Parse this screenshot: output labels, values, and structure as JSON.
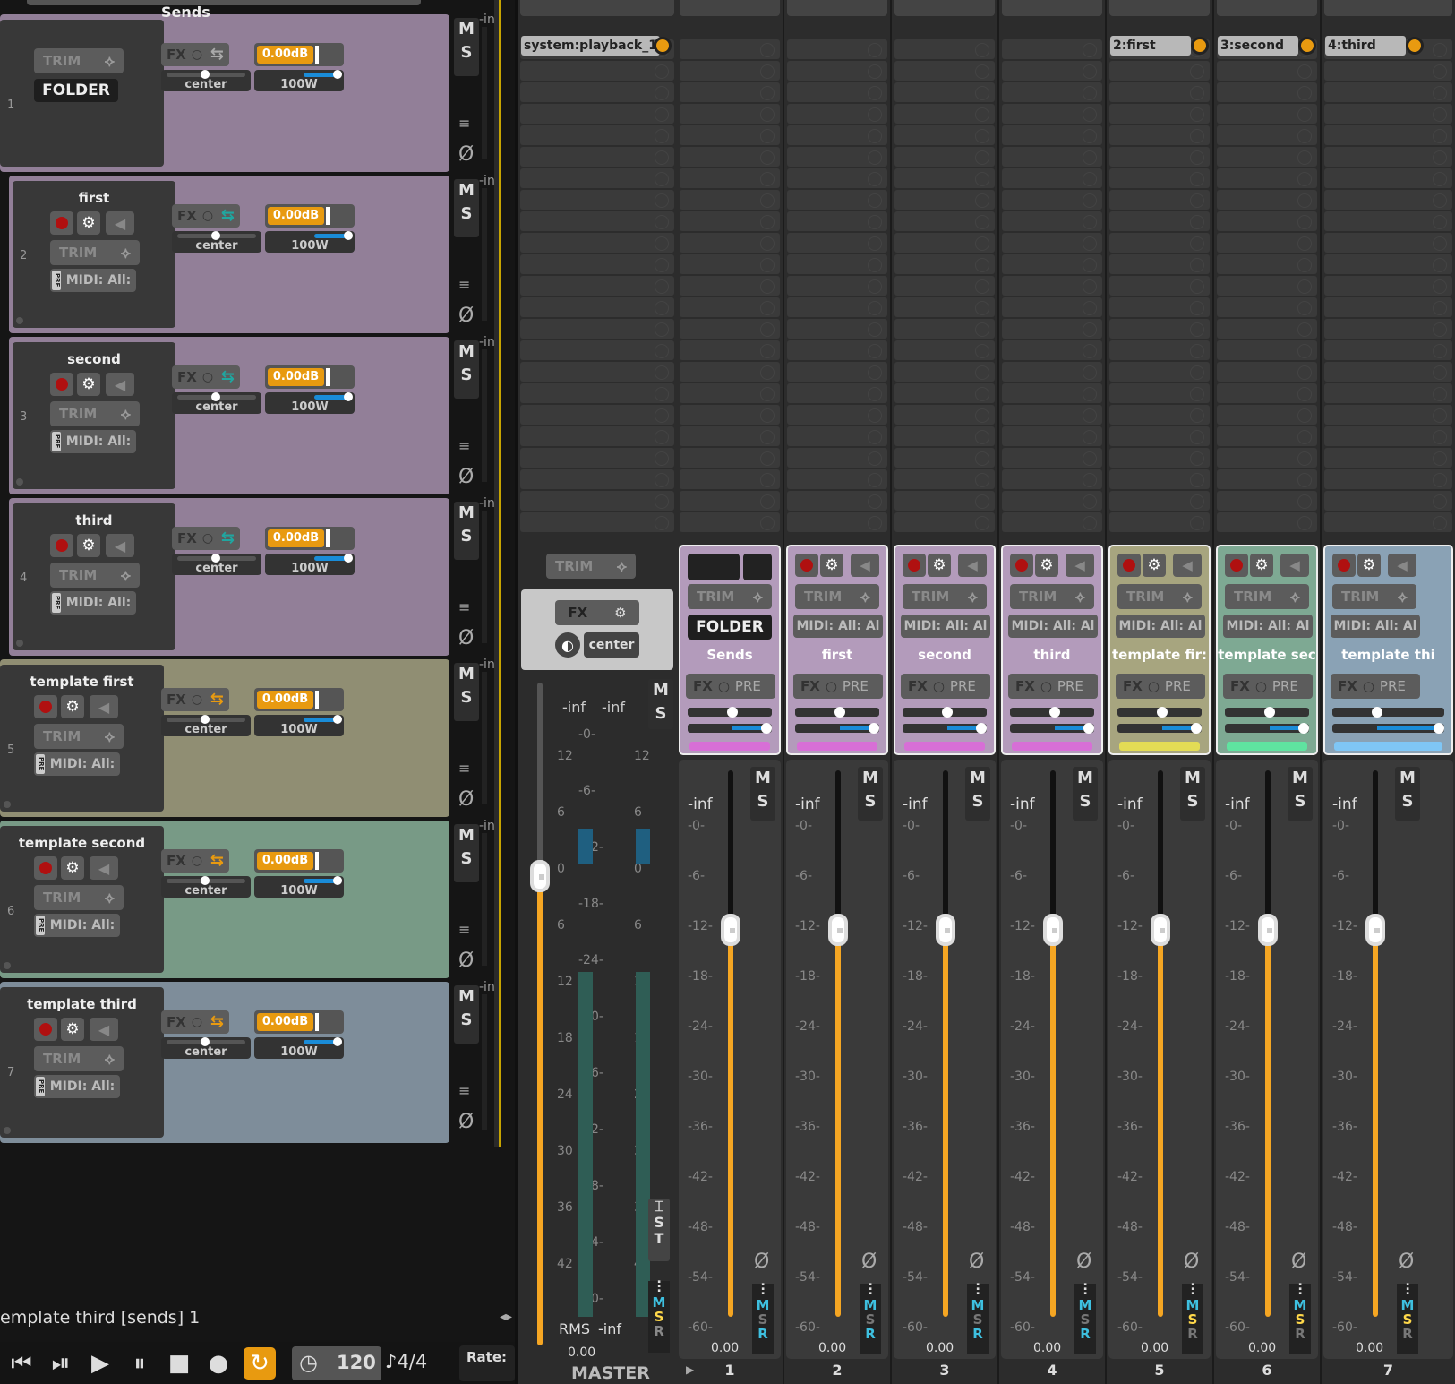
{
  "tracks": [
    {
      "name": "Sends",
      "num": "1",
      "kind": "folder",
      "folder_label": "FOLDER",
      "color": "#927f98",
      "fxcolor": "#aaa"
    },
    {
      "name": "first",
      "num": "2",
      "kind": "child",
      "color": "#927f98",
      "fxcolor": "#20a6a0"
    },
    {
      "name": "second",
      "num": "3",
      "kind": "child",
      "color": "#927f98",
      "fxcolor": "#20a6a0"
    },
    {
      "name": "third",
      "num": "4",
      "kind": "child",
      "color": "#927f98",
      "fxcolor": "#20a6a0"
    },
    {
      "name": "template first",
      "num": "5",
      "kind": "top",
      "color": "#908e73",
      "fxcolor": "#e89a10"
    },
    {
      "name": "template second",
      "num": "6",
      "kind": "top",
      "color": "#789a86",
      "fxcolor": "#e89a10"
    },
    {
      "name": "template third",
      "num": "7",
      "kind": "top",
      "color": "#7e8d9a",
      "fxcolor": "#e89a10"
    }
  ],
  "common": {
    "trim": "TRIM",
    "fx": "FX",
    "gain": "0.00dB",
    "pan": "center",
    "width": "100W",
    "midi": "MIDI: All:",
    "mute": "M",
    "solo": "S",
    "in": "-in",
    "pre": "PRE",
    "phase": "Ø"
  },
  "mixer": {
    "master": {
      "label": "MASTER",
      "port": "system:playback_1",
      "pan": "center",
      "rms": "RMS",
      "rms_val": "-inf",
      "peak": "-inf",
      "peak2": "-inf",
      "value": "0.00",
      "trim": "TRIM",
      "fx": "FX"
    },
    "strips": [
      {
        "num": "1",
        "name": "Sends",
        "port": "",
        "top_color": "#b39bbb",
        "bar": "#d76fd6",
        "folder": "FOLDER",
        "fader_val": "-inf",
        "value": "0.00"
      },
      {
        "num": "2",
        "name": "first",
        "port": "",
        "top_color": "#b39bbb",
        "bar": "#d76fd6",
        "midi": "MIDI: All: Al",
        "fader_val": "-inf",
        "value": "0.00"
      },
      {
        "num": "3",
        "name": "second",
        "port": "",
        "top_color": "#b39bbb",
        "bar": "#d76fd6",
        "midi": "MIDI: All: Al",
        "fader_val": "-inf",
        "value": "0.00"
      },
      {
        "num": "4",
        "name": "third",
        "port": "",
        "top_color": "#b39bbb",
        "bar": "#d76fd6",
        "midi": "MIDI: All: Al",
        "fader_val": "-inf",
        "value": "0.00"
      },
      {
        "num": "5",
        "name": "template fir:",
        "port": "2:first",
        "top_color": "#a7a57f",
        "bar": "#e3dc55",
        "midi": "MIDI: All: Al",
        "fader_val": "-inf",
        "value": "0.00"
      },
      {
        "num": "6",
        "name": "template sec",
        "port": "3:second",
        "top_color": "#7ea993",
        "bar": "#5fe3a0",
        "midi": "MIDI: All: Al",
        "fader_val": "-inf",
        "value": "0.00"
      },
      {
        "num": "7",
        "name": "template thi",
        "port": "4:third",
        "top_color": "#8aa2b5",
        "bar": "#7fc6f5",
        "midi": "MIDI: All: Al",
        "fader_val": "-inf",
        "value": "0.00"
      }
    ],
    "scale": [
      "-0-",
      "-6-",
      "-12-",
      "-18-",
      "-24-",
      "-30-",
      "-36-",
      "-42-",
      "-48-",
      "-54-",
      "-60-"
    ],
    "master_scale": [
      "-0-",
      "-6-",
      "-12-",
      "-18-",
      "-24-",
      "-30-",
      "-36-",
      "-42-",
      "-48-",
      "-54-",
      "-60-"
    ],
    "meter_left": [
      "12",
      "6",
      "0",
      "6",
      "12",
      "18",
      "24",
      "30",
      "36",
      "42"
    ]
  },
  "status": {
    "text": "emplate third [sends] 1"
  },
  "transport": {
    "tempo": "120",
    "meter": "4/4",
    "rate": "Rate:"
  }
}
